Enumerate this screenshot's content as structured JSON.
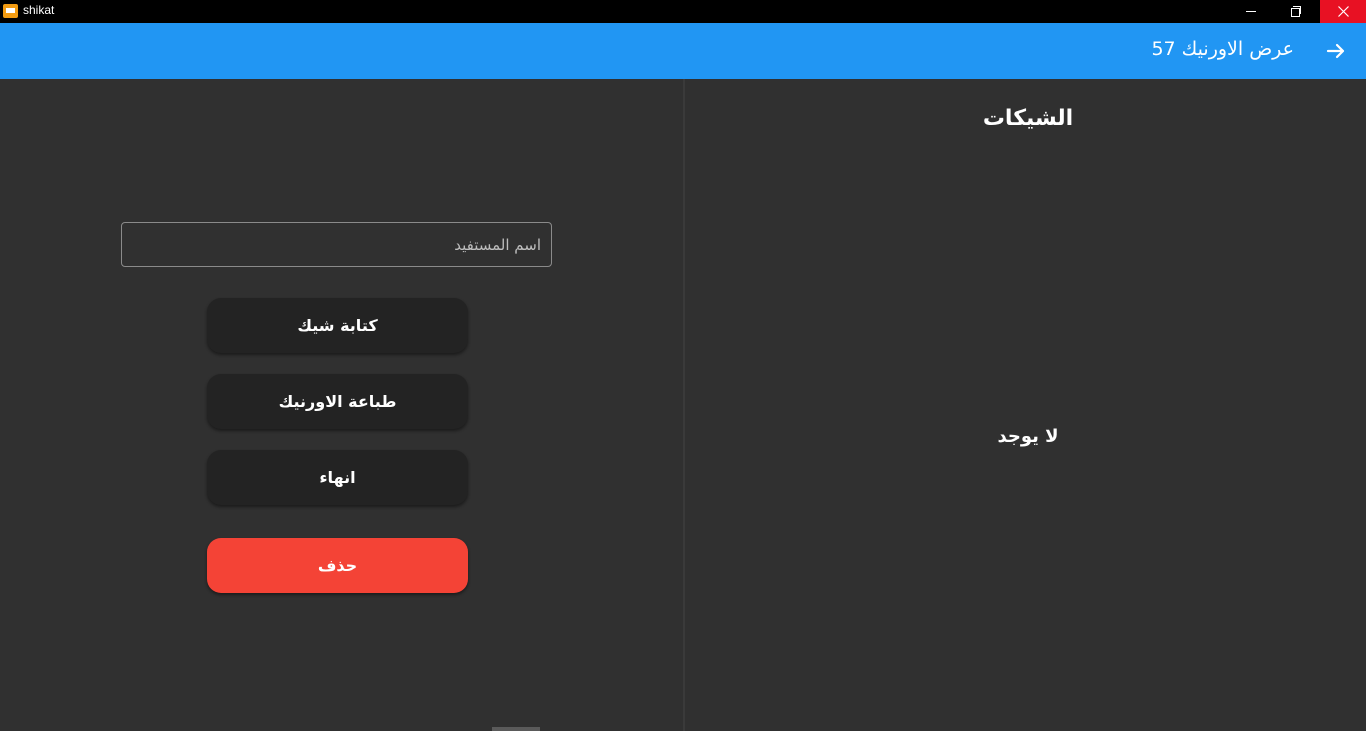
{
  "window": {
    "title": "shikat",
    "icon": "app-icon"
  },
  "appbar": {
    "title": "عرض الاورنيك 57",
    "back_icon": "arrow-right-icon",
    "color": "#2196f3"
  },
  "form": {
    "beneficiary_placeholder": "اسم المستفيد",
    "beneficiary_value": ""
  },
  "actions": {
    "write_check": "كتابة شيك",
    "print_form": "طباعة الاورنيك",
    "finish": "انهاء",
    "delete": "حذف",
    "delete_color": "#f44336"
  },
  "checks": {
    "title": "الشيكات",
    "empty_text": "لا يوجد"
  }
}
